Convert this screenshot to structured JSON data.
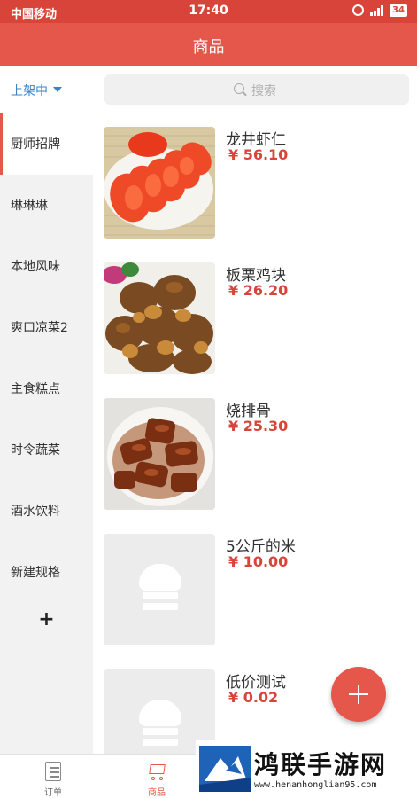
{
  "status_bar": {
    "carrier": "中国移动",
    "time": "17:40",
    "battery": "34"
  },
  "header": {
    "title": "商品"
  },
  "sidebar": {
    "status_filter": "上架中",
    "categories": [
      {
        "label": "厨师招牌",
        "active": true
      },
      {
        "label": "琳琳琳"
      },
      {
        "label": "本地风味"
      },
      {
        "label": "爽口凉菜2"
      },
      {
        "label": "主食糕点"
      },
      {
        "label": "时令蔬菜"
      },
      {
        "label": "酒水饮料"
      },
      {
        "label": "新建规格"
      }
    ],
    "add_label": "+"
  },
  "search": {
    "placeholder": "搜索"
  },
  "products": [
    {
      "name": "龙井虾仁",
      "price": "¥ 56.10",
      "image": "tomato-slices"
    },
    {
      "name": "板栗鸡块",
      "price": "¥ 26.20",
      "image": "chestnut-chicken"
    },
    {
      "name": "烧排骨",
      "price": "¥ 25.30",
      "image": "braised-ribs"
    },
    {
      "name": "5公斤的米",
      "price": "¥ 10.00",
      "image": "placeholder-chef-hat"
    },
    {
      "name": "低价测试",
      "price": "¥ 0.02",
      "image": "placeholder-chef-hat"
    }
  ],
  "tabbar": [
    {
      "label": "订单",
      "icon": "document-icon"
    },
    {
      "label": "商品",
      "icon": "cart-icon",
      "active": true
    }
  ],
  "watermark": {
    "title": "鸿联手游网",
    "url": "www.henanhonglian95.com"
  },
  "colors": {
    "brand_red": "#e5564b",
    "status_red": "#d9443a",
    "price_red": "#d9443a",
    "link_blue": "#3b82c4"
  }
}
